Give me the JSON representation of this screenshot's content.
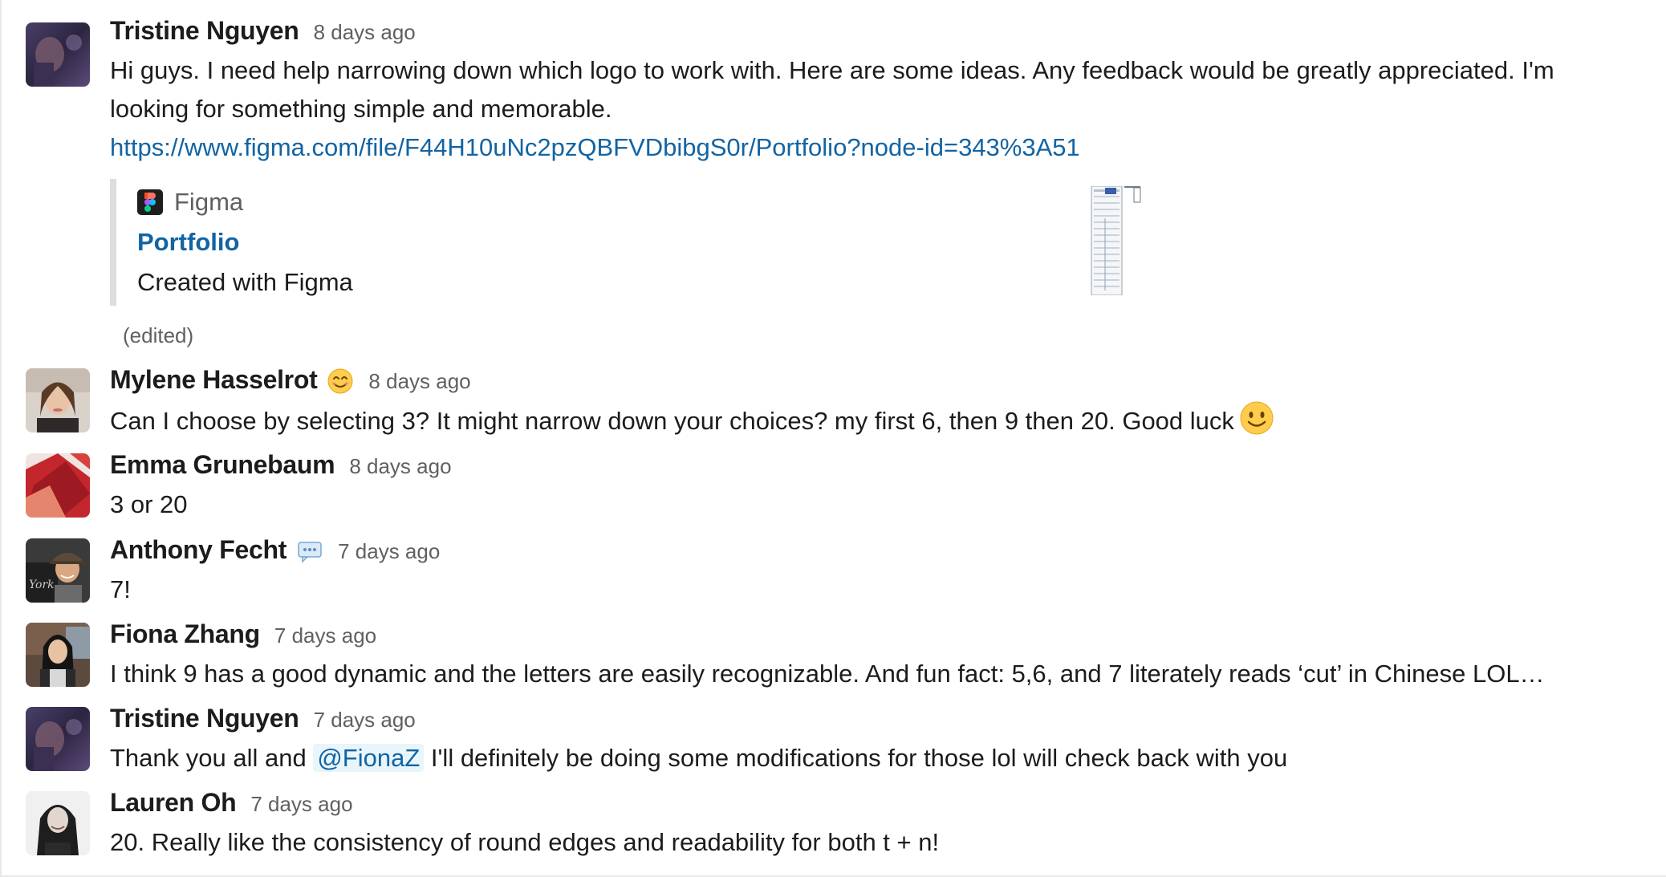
{
  "messages": [
    {
      "sender": "Tristine Nguyen",
      "time": "8 days ago",
      "avatar": "tristine-avatar",
      "lines": [
        "Hi guys. I need help narrowing down which logo to work with. Here are some ideas. Any feedback would be greatly appreciated. I'm",
        "looking for something simple and memorable."
      ],
      "link": "https://www.figma.com/file/F44H10uNc2pzQBFVDbibgS0r/Portfolio?node-id=343%3A51",
      "unfurl": {
        "service": "Figma",
        "title": "Portfolio",
        "description": "Created with Figma"
      },
      "edited": "(edited)"
    },
    {
      "sender": "Mylene Hasselrot",
      "status_emoji": "smiling-face-icon",
      "time": "8 days ago",
      "text": "Can I choose by selecting 3? It might narrow down your choices? my first 6, then 9 then 20. Good luck",
      "trailing_emoji": "slightly-smiling-face-icon"
    },
    {
      "sender": "Emma Grunebaum",
      "time": "8 days ago",
      "text": "3 or 20"
    },
    {
      "sender": "Anthony Fecht",
      "status_emoji": "speech-bubble-icon",
      "time": "7 days ago",
      "text": "7!"
    },
    {
      "sender": "Fiona Zhang",
      "time": "7 days ago",
      "text": "I think 9 has a good dynamic and the letters are easily recognizable. And fun fact: 5,6, and 7 literately reads ‘cut’ in Chinese LOL…"
    },
    {
      "sender": "Tristine Nguyen",
      "time": "7 days ago",
      "text_before": "Thank you all and ",
      "mention": "@FionaZ",
      "text_after": " I'll definitely be doing some modifications for those lol will check back with you"
    },
    {
      "sender": "Lauren Oh",
      "time": "7 days ago",
      "text": "20. Really like the consistency of round edges and readability for both t + n!"
    }
  ],
  "colors": {
    "link": "#1264a3",
    "mention_bg": "#e8f5fa",
    "text": "#1d1c1d",
    "muted": "#616061"
  }
}
